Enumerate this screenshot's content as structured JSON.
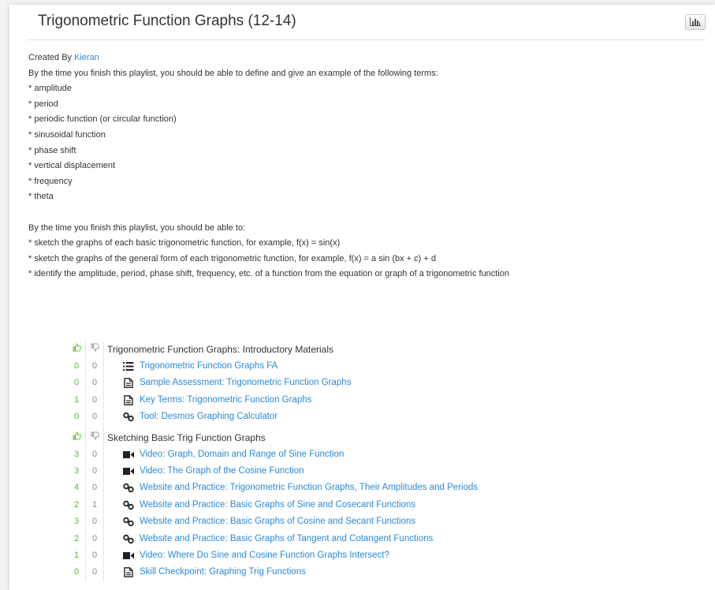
{
  "header": {
    "title": "Trigonometric Function Graphs (12-14)",
    "stats_icon": "bar-chart-icon"
  },
  "description": {
    "created_by_label": "Created By",
    "author": "Kieran",
    "intro1": "By the time you finish this playlist, you should be able to define and give an example of the following terms:",
    "terms": [
      "* amplitude",
      "* period",
      "* periodic function (or circular function)",
      "* sinusoidal function",
      "* phase shift",
      "* vertical displacement",
      "* frequency",
      "* theta"
    ],
    "intro2": "By the time you finish this playlist, you should be able to:",
    "goals": [
      "* sketch the graphs of each basic trigonometric function, for example, f(x) = sin(x)",
      "* sketch the graphs of the general form of each trigonometric function, for example, f(x) = a sin (bx + c) + d",
      "* identify the amplitude, period, phase shift, frequency, etc. of a function from the equation or graph of a trigonometric function"
    ]
  },
  "sections": [
    {
      "title": "Trigonometric Function Graphs: Introductory Materials",
      "items": [
        {
          "up": "0",
          "down": "0",
          "icon": "quiz-list-icon",
          "label": "Trigonometric Function Graphs FA"
        },
        {
          "up": "0",
          "down": "0",
          "icon": "document-icon",
          "label": "Sample Assessment: Trigonometric Function Graphs"
        },
        {
          "up": "1",
          "down": "0",
          "icon": "document-icon",
          "label": "Key Terms: Trigonometric Function Graphs"
        },
        {
          "up": "0",
          "down": "0",
          "icon": "link-icon",
          "label": "Tool: Desmos Graphing Calculator"
        }
      ]
    },
    {
      "title": "Sketching Basic Trig Function Graphs",
      "items": [
        {
          "up": "3",
          "down": "0",
          "icon": "video-icon",
          "label": "Video: Graph, Domain and Range of Sine Function"
        },
        {
          "up": "3",
          "down": "0",
          "icon": "video-icon",
          "label": "Video: The Graph of the Cosine Function"
        },
        {
          "up": "4",
          "down": "0",
          "icon": "link-icon",
          "label": "Website and Practice: Trigonometric Function Graphs, Their Amplitudes and Periods"
        },
        {
          "up": "2",
          "down": "1",
          "icon": "link-icon",
          "label": "Website and Practice: Basic Graphs of Sine and Cosecant Functions"
        },
        {
          "up": "3",
          "down": "0",
          "icon": "link-icon",
          "label": "Website and Practice: Basic Graphs of Cosine and Secant Functions"
        },
        {
          "up": "2",
          "down": "0",
          "icon": "link-icon",
          "label": "Website and Practice: Basic Graphs of Tangent and Cotangent Functions"
        },
        {
          "up": "1",
          "down": "0",
          "icon": "video-icon",
          "label": "Video: Where Do Sine and Cosine Function Graphs Intersect?"
        },
        {
          "up": "0",
          "down": "0",
          "icon": "document-icon",
          "label": "Skill Checkpoint: Graphing Trig Functions"
        }
      ]
    }
  ],
  "colors": {
    "link": "#2a8ad3",
    "thumbs_up": "#58b833",
    "text": "#333333"
  }
}
